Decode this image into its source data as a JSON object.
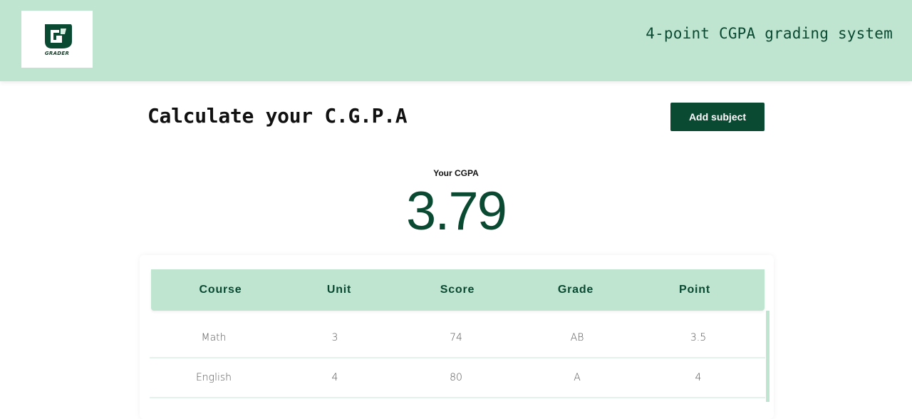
{
  "header": {
    "logo_text": "GRADER",
    "system_title": "4-point CGPA grading system"
  },
  "main": {
    "title": "Calculate your C.G.P.A",
    "add_button_label": "Add subject",
    "cgpa_label": "Your CGPA",
    "cgpa_value": "3.79"
  },
  "table": {
    "columns": [
      "Course",
      "Unit",
      "Score",
      "Grade",
      "Point"
    ],
    "rows": [
      [
        "Math",
        "3",
        "74",
        "AB",
        "3.5"
      ],
      [
        "English",
        "4",
        "80",
        "A",
        "4"
      ]
    ]
  },
  "colors": {
    "accent": "#0a4a32",
    "header_bg": "#bfe5d0"
  },
  "icons": {
    "logo": "grader-logo-icon"
  }
}
